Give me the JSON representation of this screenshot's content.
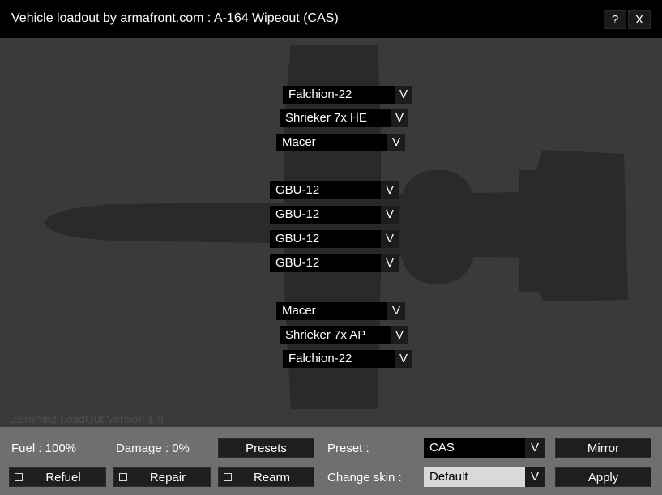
{
  "window": {
    "title": "Vehicle loadout by armafront.com : A-164 Wipeout (CAS)",
    "help_label": "?",
    "close_label": "X"
  },
  "pylons": [
    {
      "weapon": "Falchion-22"
    },
    {
      "weapon": "Shrieker 7x HE"
    },
    {
      "weapon": "Macer"
    },
    {
      "weapon": "GBU-12"
    },
    {
      "weapon": "GBU-12"
    },
    {
      "weapon": "GBU-12"
    },
    {
      "weapon": "GBU-12"
    },
    {
      "weapon": "Macer"
    },
    {
      "weapon": "Shrieker 7x AP"
    },
    {
      "weapon": "Falchion-22"
    }
  ],
  "dropdown_arrow": "V",
  "version_text": "ZeroAinz LoadOut Version 1.0",
  "status": {
    "fuel": "Fuel : 100%",
    "damage": "Damage : 0%"
  },
  "actions": {
    "presets": "Presets",
    "refuel": "Refuel",
    "repair": "Repair",
    "rearm": "Rearm",
    "mirror": "Mirror",
    "apply": "Apply"
  },
  "preset": {
    "label": "Preset :",
    "value": "CAS"
  },
  "skin": {
    "label": "Change skin :",
    "value": "Default"
  },
  "colors": {
    "panel_bg": "#3a3a3a",
    "silhouette": "#2a2a2a",
    "bottom_bar": "#6f6f6f",
    "skin_field": "#d9d9d9"
  }
}
